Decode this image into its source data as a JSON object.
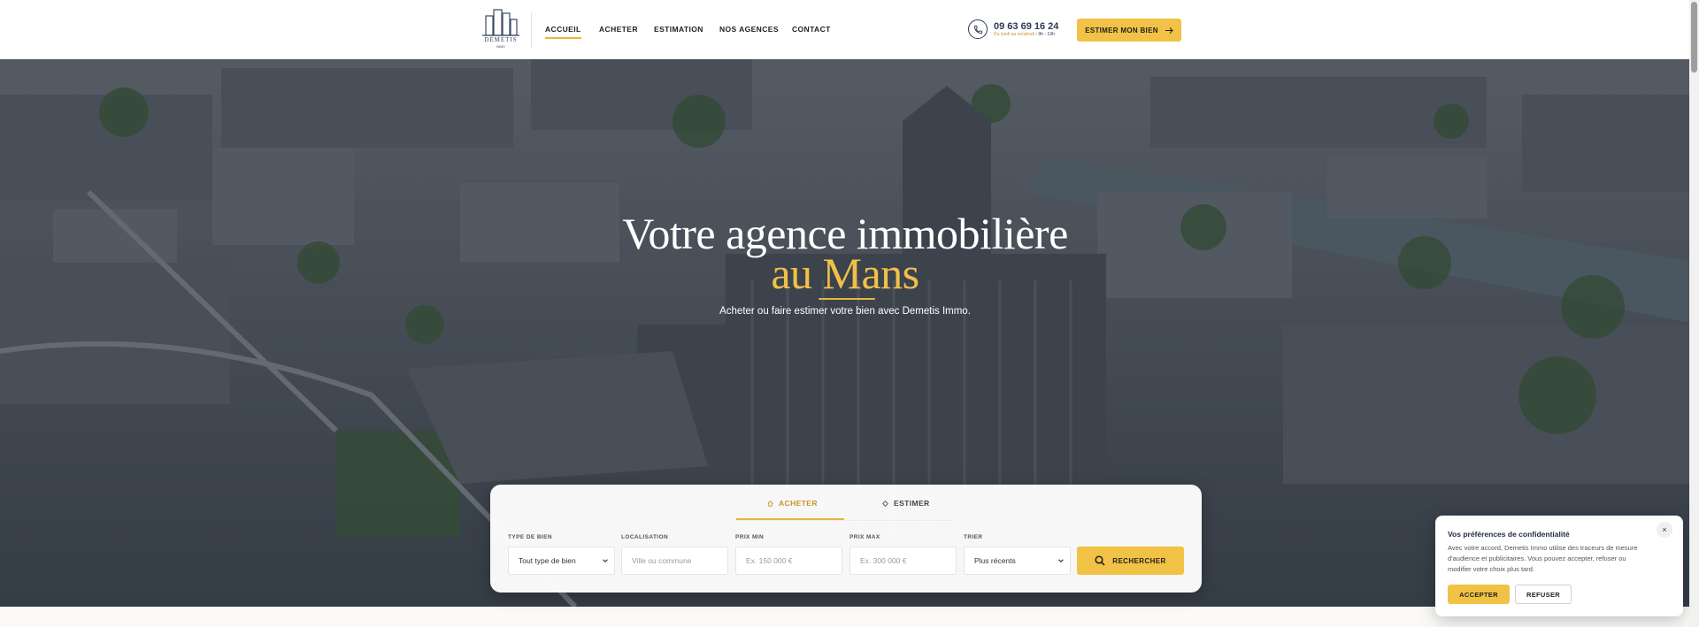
{
  "header": {
    "logo_text": "DEMETIS",
    "logo_sub": "IMMO",
    "nav": [
      {
        "label": "ACCUEIL",
        "active": true
      },
      {
        "label": "ACHETER",
        "active": false
      },
      {
        "label": "ESTIMATION",
        "active": false
      },
      {
        "label": "NOS AGENCES",
        "active": false
      },
      {
        "label": "CONTACT",
        "active": false
      }
    ],
    "phone": "09 63 69 16 24",
    "phone_hours_days": "Du lundi au vendredi",
    "phone_hours_time": "9h - 19h",
    "cta_label": "ESTIMER MON BIEN",
    "cta_icon": "arrow-right-icon"
  },
  "hero": {
    "title_line1": "Votre agence immobilière",
    "title_line2": "au Mans",
    "subtitle": "Acheter ou faire estimer votre bien avec Demetis Immo."
  },
  "search": {
    "tabs": [
      {
        "label": "ACHETER",
        "icon": "home-icon",
        "active": true
      },
      {
        "label": "ESTIMER",
        "icon": "diamond-icon",
        "active": false
      }
    ],
    "fields": {
      "type": {
        "label": "TYPE DE BIEN",
        "value": "Tout type de bien"
      },
      "location": {
        "label": "LOCALISATION",
        "placeholder": "Ville ou commune"
      },
      "price_min": {
        "label": "PRIX MIN",
        "placeholder": "Ex. 150 000 €"
      },
      "price_max": {
        "label": "PRIX MAX",
        "placeholder": "Ex. 300 000 €"
      },
      "sort": {
        "label": "TRIER",
        "value": "Plus récents"
      }
    },
    "submit_label": "RECHERCHER"
  },
  "cookie": {
    "title": "Vos préférences de confidentialité",
    "text": "Avec votre accord, Demetis Immo utilise des traceurs de mesure d'audience et publicitaires. Vous pouvez accepter, refuser ou modifier votre choix plus tard.",
    "accept_label": "ACCEPTER",
    "refuse_label": "REFUSER",
    "close_label": "×"
  },
  "colors": {
    "accent": "#f1c245",
    "navy": "#2c3a55",
    "gold_text": "#f0c04a"
  }
}
